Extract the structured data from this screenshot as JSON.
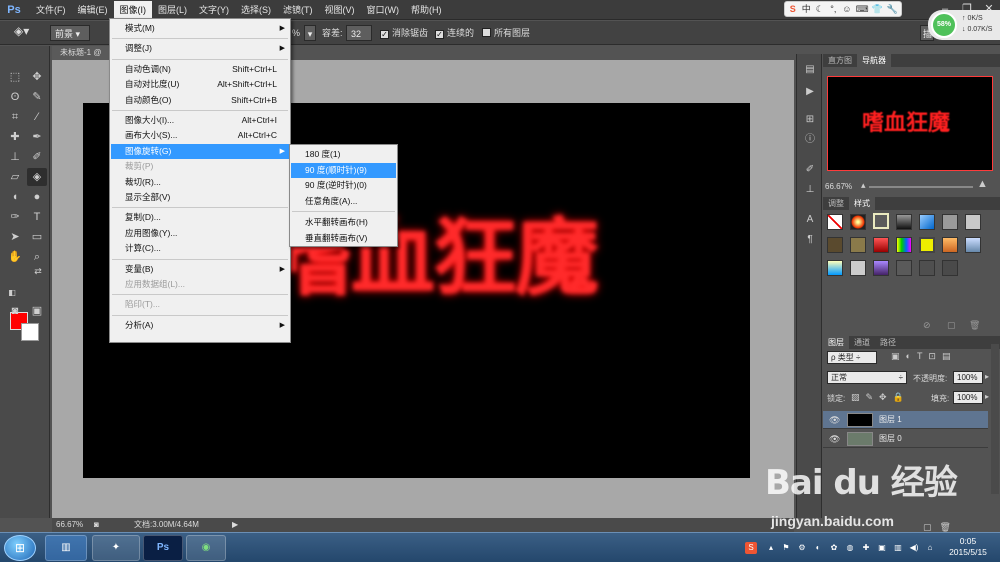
{
  "app": {
    "logo": "Ps"
  },
  "menubar": {
    "items": [
      "文件(F)",
      "编辑(E)",
      "图像(I)",
      "图层(L)",
      "文字(Y)",
      "选择(S)",
      "滤镜(T)",
      "视图(V)",
      "窗口(W)",
      "帮助(H)"
    ],
    "active_index": 2
  },
  "options_bar": {
    "preset": "前景",
    "percent_partial": "%",
    "tolerance_label": "容差:",
    "tolerance_value": "32",
    "anti_alias": "消除锯齿",
    "contiguous": "连续的",
    "all_layers": "所有图层",
    "right_btn": "插"
  },
  "net_meter": {
    "percent": "58%",
    "up": "0K/S",
    "down": "0.07K/S"
  },
  "doc_tab": {
    "title": "未标题-1 @"
  },
  "canvas": {
    "text": "嗜血狂魔",
    "text_color": "#ff2a2a"
  },
  "status": {
    "zoom": "66.67%",
    "doc": "文档:3.00M/4.64M"
  },
  "image_menu": {
    "items": [
      {
        "label": "模式(M)",
        "shortcut": "",
        "submenu": true,
        "disabled": false
      },
      {
        "sep": true
      },
      {
        "label": "调整(J)",
        "shortcut": "",
        "submenu": true,
        "disabled": false
      },
      {
        "sep": true
      },
      {
        "label": "自动色调(N)",
        "shortcut": "Shift+Ctrl+L",
        "submenu": false,
        "disabled": false
      },
      {
        "label": "自动对比度(U)",
        "shortcut": "Alt+Shift+Ctrl+L",
        "submenu": false,
        "disabled": false
      },
      {
        "label": "自动颜色(O)",
        "shortcut": "Shift+Ctrl+B",
        "submenu": false,
        "disabled": false
      },
      {
        "sep": true
      },
      {
        "label": "图像大小(I)...",
        "shortcut": "Alt+Ctrl+I",
        "submenu": false,
        "disabled": false
      },
      {
        "label": "画布大小(S)...",
        "shortcut": "Alt+Ctrl+C",
        "submenu": false,
        "disabled": false
      },
      {
        "label": "图像旋转(G)",
        "shortcut": "",
        "submenu": true,
        "disabled": false,
        "highlighted": true
      },
      {
        "label": "裁剪(P)",
        "shortcut": "",
        "submenu": false,
        "disabled": true
      },
      {
        "label": "裁切(R)...",
        "shortcut": "",
        "submenu": false,
        "disabled": false
      },
      {
        "label": "显示全部(V)",
        "shortcut": "",
        "submenu": false,
        "disabled": false
      },
      {
        "sep": true
      },
      {
        "label": "复制(D)...",
        "shortcut": "",
        "submenu": false,
        "disabled": false
      },
      {
        "label": "应用图像(Y)...",
        "shortcut": "",
        "submenu": false,
        "disabled": false
      },
      {
        "label": "计算(C)...",
        "shortcut": "",
        "submenu": false,
        "disabled": false
      },
      {
        "sep": true
      },
      {
        "label": "变量(B)",
        "shortcut": "",
        "submenu": true,
        "disabled": false
      },
      {
        "label": "应用数据组(L)...",
        "shortcut": "",
        "submenu": false,
        "disabled": true
      },
      {
        "sep": true
      },
      {
        "label": "陷印(T)...",
        "shortcut": "",
        "submenu": false,
        "disabled": true
      },
      {
        "sep": true
      },
      {
        "label": "分析(A)",
        "shortcut": "",
        "submenu": true,
        "disabled": false
      }
    ]
  },
  "rotate_menu": {
    "items": [
      {
        "label": "180 度(1)",
        "highlighted": false
      },
      {
        "label": "90 度(顺时针)(9)",
        "highlighted": true
      },
      {
        "label": "90 度(逆时针)(0)",
        "highlighted": false
      },
      {
        "label": "任意角度(A)...",
        "highlighted": false
      },
      {
        "sep": true
      },
      {
        "label": "水平翻转画布(H)",
        "highlighted": false
      },
      {
        "label": "垂直翻转画布(V)",
        "highlighted": false
      }
    ]
  },
  "navigator": {
    "tabs": [
      "直方图",
      "导航器"
    ],
    "active_tab": 1,
    "thumb_text": "嗜血狂魔",
    "zoom": "66.67%"
  },
  "styles_panel": {
    "tabs": [
      "调整",
      "样式"
    ],
    "active_tab": 1
  },
  "layers_panel": {
    "tabs": [
      "图层",
      "通道",
      "路径"
    ],
    "active_tab": 0,
    "kind": "ρ 类型",
    "blend_mode": "正常",
    "opacity_label": "不透明度:",
    "opacity": "100%",
    "lock_label": "锁定:",
    "fill_label": "填充:",
    "fill": "100%",
    "layers": [
      {
        "name": "图层 1",
        "selected": true,
        "thumb": "#000000"
      },
      {
        "name": "图层 0",
        "selected": false,
        "thumb": "#6b7b6b"
      }
    ]
  },
  "taskbar": {
    "clock_time": "0:05",
    "clock_date": "2015/5/15"
  },
  "watermark": {
    "logo": "Bai du 经验",
    "url": "jingyan.baidu.com"
  }
}
